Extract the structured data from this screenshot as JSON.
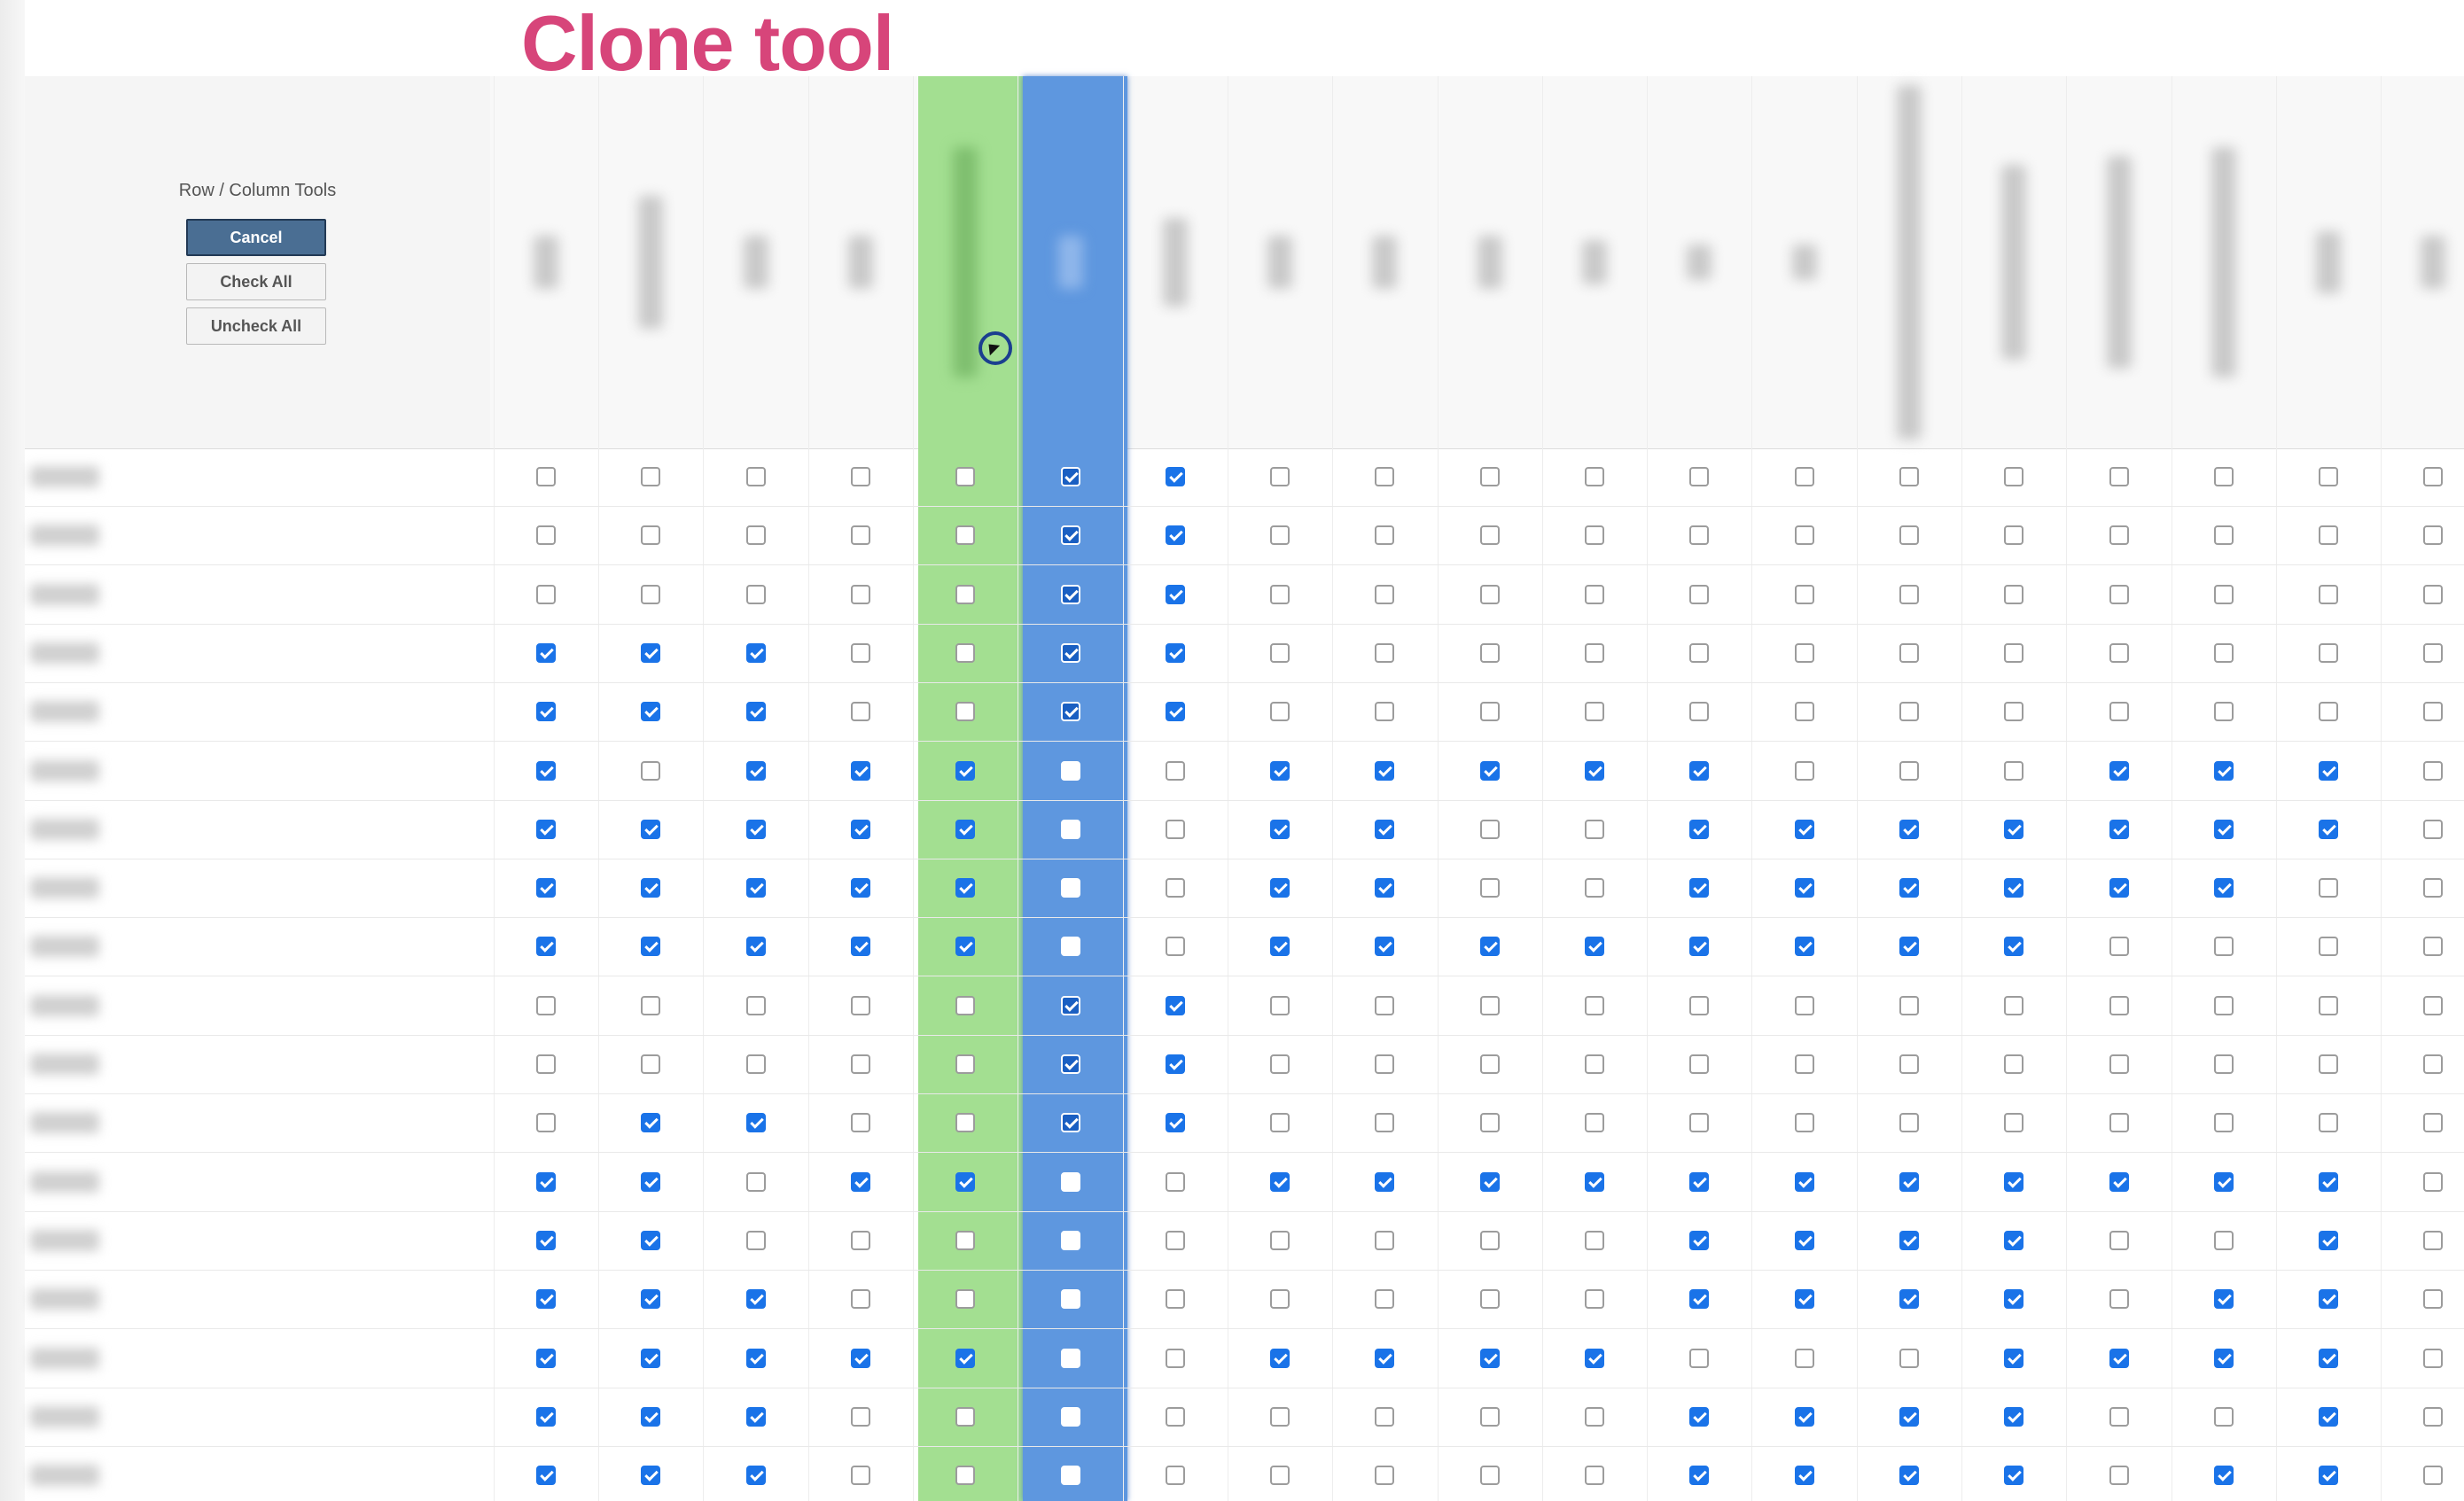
{
  "overlay": {
    "title": "Clone tool"
  },
  "tools": {
    "heading": "Row / Column Tools",
    "cancel_label": "Cancel",
    "check_all_label": "Check All",
    "uncheck_all_label": "Uncheck All"
  },
  "colors": {
    "overlay_title": "#d7457a",
    "source_column": "#a3df91",
    "target_column": "#5e97df",
    "checkbox_checked": "#1a73e8",
    "cancel_button": "#4a6e93"
  },
  "grid": {
    "source_column_index": 4,
    "target_column_index": 5,
    "rows": [
      "0000011000000000000",
      "0000011000000000000",
      "0000011000000000000",
      "1110011000000000000",
      "1110011000000000000",
      "1011100111110001110",
      "1111100110011111110",
      "1111100110011111100",
      "1111100111111110000",
      "0000011000000000000",
      "0000011000000000000",
      "0110011000000000000",
      "1101100111111111110",
      "1100000000011110010",
      "1110000000011110110",
      "1111100111100011110",
      "1110000000011110010",
      "1110000000011110110"
    ]
  }
}
